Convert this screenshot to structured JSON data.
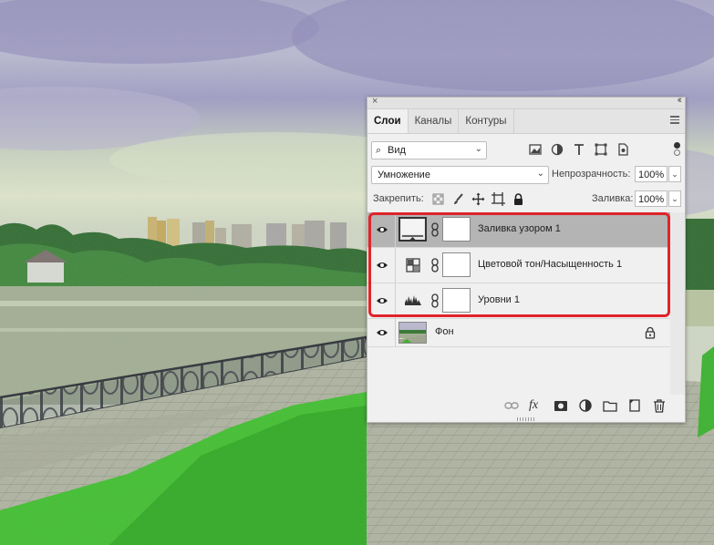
{
  "panel": {
    "close_glyph": "×",
    "collapse_glyph": "‹‹",
    "tabs": [
      {
        "label": "Слои",
        "active": true
      },
      {
        "label": "Каналы",
        "active": false
      },
      {
        "label": "Контуры",
        "active": false
      }
    ]
  },
  "filter": {
    "kind_label": "Вид",
    "icons": [
      "pixel-filter-icon",
      "adjustment-filter-icon",
      "type-filter-icon",
      "shape-filter-icon",
      "smart-object-filter-icon"
    ]
  },
  "blend": {
    "mode": "Умножение",
    "opacity_label": "Непрозрачность:",
    "opacity_value": "100%"
  },
  "lock": {
    "label": "Закрепить:",
    "fill_label": "Заливка:",
    "fill_value": "100%"
  },
  "layers": [
    {
      "name": "Заливка узором 1",
      "type": "pattern-fill",
      "selected": true,
      "visible": true
    },
    {
      "name": "Цветовой тон/Насыщенность 1",
      "type": "hue-saturation",
      "selected": false,
      "visible": true
    },
    {
      "name": "Уровни 1",
      "type": "levels",
      "selected": false,
      "visible": true
    },
    {
      "name": "Фон",
      "type": "background",
      "selected": false,
      "visible": true,
      "locked": true
    }
  ],
  "bottom_icons": [
    "link-layers-icon",
    "fx-icon",
    "add-mask-icon",
    "new-adjustment-icon",
    "new-group-icon",
    "new-layer-icon",
    "delete-layer-icon"
  ],
  "bottom_fx_label": "fx",
  "colors": {
    "highlight": "#e0242a",
    "selected_row": "#b4b4b4",
    "panel_bg": "#f0f0f0"
  }
}
